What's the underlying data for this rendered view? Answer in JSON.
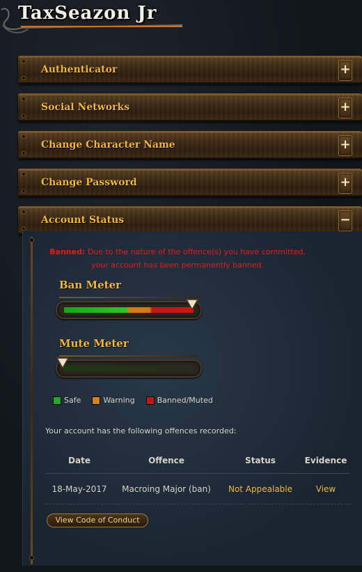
{
  "header": {
    "title": "TaxSeazon Jr"
  },
  "panels": [
    {
      "label": "Authenticator",
      "toggle": "+"
    },
    {
      "label": "Social Networks",
      "toggle": "+"
    },
    {
      "label": "Change Character Name",
      "toggle": "+"
    },
    {
      "label": "Change Password",
      "toggle": "+"
    },
    {
      "label": "Account Status",
      "toggle": "−"
    }
  ],
  "account_status": {
    "banned_label": "Banned:",
    "banned_text": " Due to the nature of the offence(s) you have committed, your account has been permanently banned.",
    "ban_meter": {
      "title": "Ban Meter",
      "level": 1.0
    },
    "mute_meter": {
      "title": "Mute Meter",
      "level": 0.0
    },
    "legend": [
      {
        "label": "Safe",
        "color": "#1fae22"
      },
      {
        "label": "Warning",
        "color": "#d9801a"
      },
      {
        "label": "Banned/Muted",
        "color": "#c81414"
      }
    ],
    "offences_intro": "Your account has the following offences recorded:",
    "table": {
      "headers": [
        "Date",
        "Offence",
        "Status",
        "Evidence"
      ],
      "rows": [
        {
          "date": "18-May-2017",
          "offence": "Macroing Major (ban)",
          "status": "Not Appealable",
          "evidence": "View"
        }
      ]
    },
    "code_of_conduct_button": "View Code of Conduct"
  },
  "colors": {
    "accent": "#f2b53a",
    "banned_text": "#e41a1a"
  }
}
